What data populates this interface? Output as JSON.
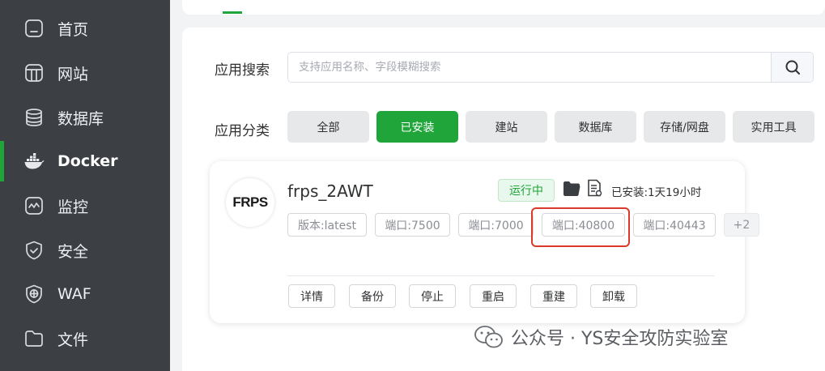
{
  "sidebar": {
    "items": [
      {
        "label": "首页",
        "icon": "home-icon"
      },
      {
        "label": "网站",
        "icon": "website-icon"
      },
      {
        "label": "数据库",
        "icon": "database-icon"
      },
      {
        "label": "Docker",
        "icon": "docker-icon",
        "active": true
      },
      {
        "label": "监控",
        "icon": "monitor-icon"
      },
      {
        "label": "安全",
        "icon": "shield-icon"
      },
      {
        "label": "WAF",
        "icon": "waf-icon"
      },
      {
        "label": "文件",
        "icon": "folder-icon"
      }
    ]
  },
  "search": {
    "label": "应用搜索",
    "placeholder": "支持应用名称、字段模糊搜索",
    "value": ""
  },
  "categories": {
    "label": "应用分类",
    "items": [
      "全部",
      "已安装",
      "建站",
      "数据库",
      "存储/网盘",
      "实用工具"
    ],
    "active": "已安装"
  },
  "app": {
    "logo_text": "FRPS",
    "name": "frps_2AWT",
    "status": "运行中",
    "installed": "已安装:1天19小时",
    "tags": [
      "版本:latest",
      "端口:7500",
      "端口:7000",
      "端口:40800",
      "端口:40443",
      "+2"
    ],
    "actions": [
      "详情",
      "备份",
      "停止",
      "重启",
      "重建",
      "卸载"
    ]
  },
  "watermark": {
    "text": "公众号 · YS安全攻防实验室"
  },
  "colors": {
    "sidebar_bg": "#3c3f44",
    "accent": "#20a53a",
    "highlight": "#d93a2b"
  }
}
